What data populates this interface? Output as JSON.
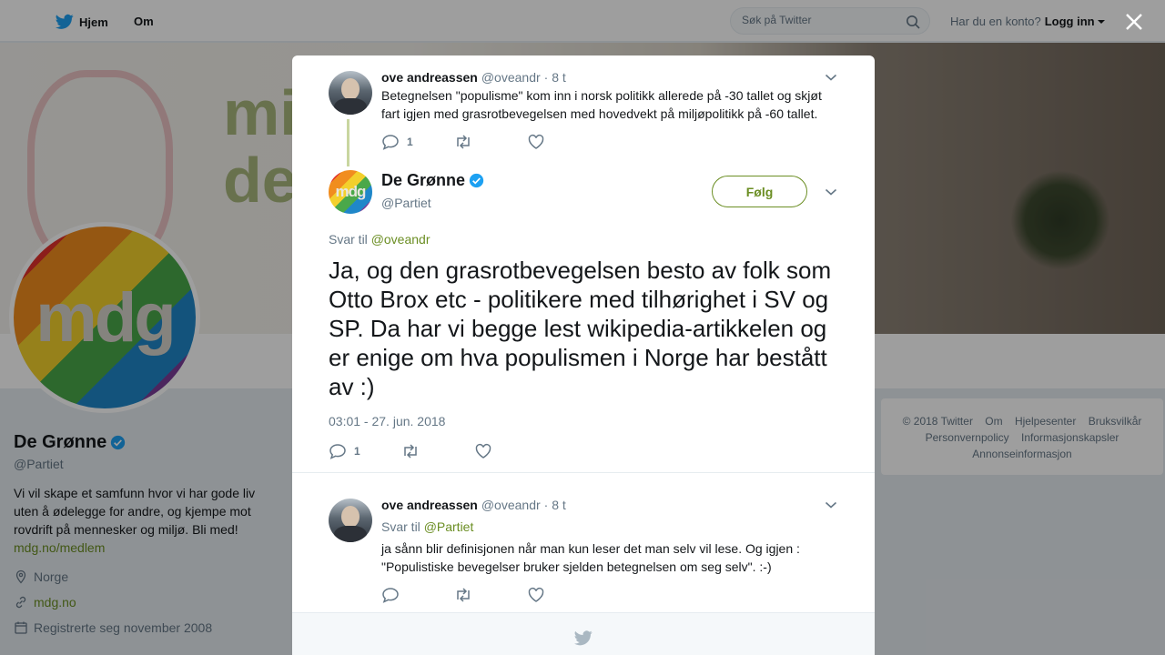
{
  "nav": {
    "home_label": "Hjem",
    "about_label": "Om"
  },
  "search": {
    "placeholder": "Søk på Twitter"
  },
  "login": {
    "prompt": "Har du en konto?",
    "link": "Logg inn"
  },
  "banner": {
    "text_line1": "mi",
    "text_line2": "de"
  },
  "profile": {
    "avatar_text": "mdg",
    "name": "De Grønne",
    "handle": "@Partiet",
    "bio": "Vi vil skape et samfunn hvor vi har gode liv uten å ødelegge for andre, og kjempe mot rovdrift på mennesker og miljø. Bli med!",
    "bio_link": "mdg.no/medlem",
    "location": "Norge",
    "website": "mdg.no",
    "joined": "Registrerte seg november 2008"
  },
  "footer": {
    "items": [
      "© 2018 Twitter",
      "Om",
      "Hjelpesenter",
      "Bruksvilkår",
      "Personvernpolicy",
      "Informasjonskapsler",
      "Annonseinformasjon"
    ]
  },
  "modal": {
    "parent": {
      "name": "ove andreassen",
      "handle": "@oveandr",
      "time": "· 8 t",
      "text": "Betegnelsen \"populisme\" kom inn i norsk politikk allerede på -30 tallet og skjøt fart igjen med grasrotbevegelsen med hovedvekt på miljøpolitikk på -60 tallet.",
      "reply_count": "1"
    },
    "main": {
      "avatar_text": "mdg",
      "name": "De Grønne",
      "handle": "@Partiet",
      "follow_label": "Følg",
      "reply_prefix": "Svar til",
      "reply_to": "@oveandr",
      "text": "Ja, og den grasrotbevegelsen besto av folk som Otto Brox etc - politikere med tilhørighet i SV og SP. Da har vi begge lest wikipedia-artikkelen og er enige om hva populismen i Norge har bestått av :)",
      "timestamp": "03:01 - 27. jun. 2018",
      "reply_count": "1"
    },
    "reply": {
      "name": "ove andreassen",
      "handle": "@oveandr",
      "time": "· 8 t",
      "reply_prefix": "Svar til",
      "reply_to": "@Partiet",
      "text": "ja sånn blir definisjonen når man kun leser det man selv vil lese. Og igjen : \"Populistiske bevegelser bruker sjelden betegnelsen om seg selv\". :-)"
    }
  },
  "colors": {
    "accent": "#6b8e23",
    "twitter_blue": "#1da1f2",
    "muted": "#657786"
  }
}
